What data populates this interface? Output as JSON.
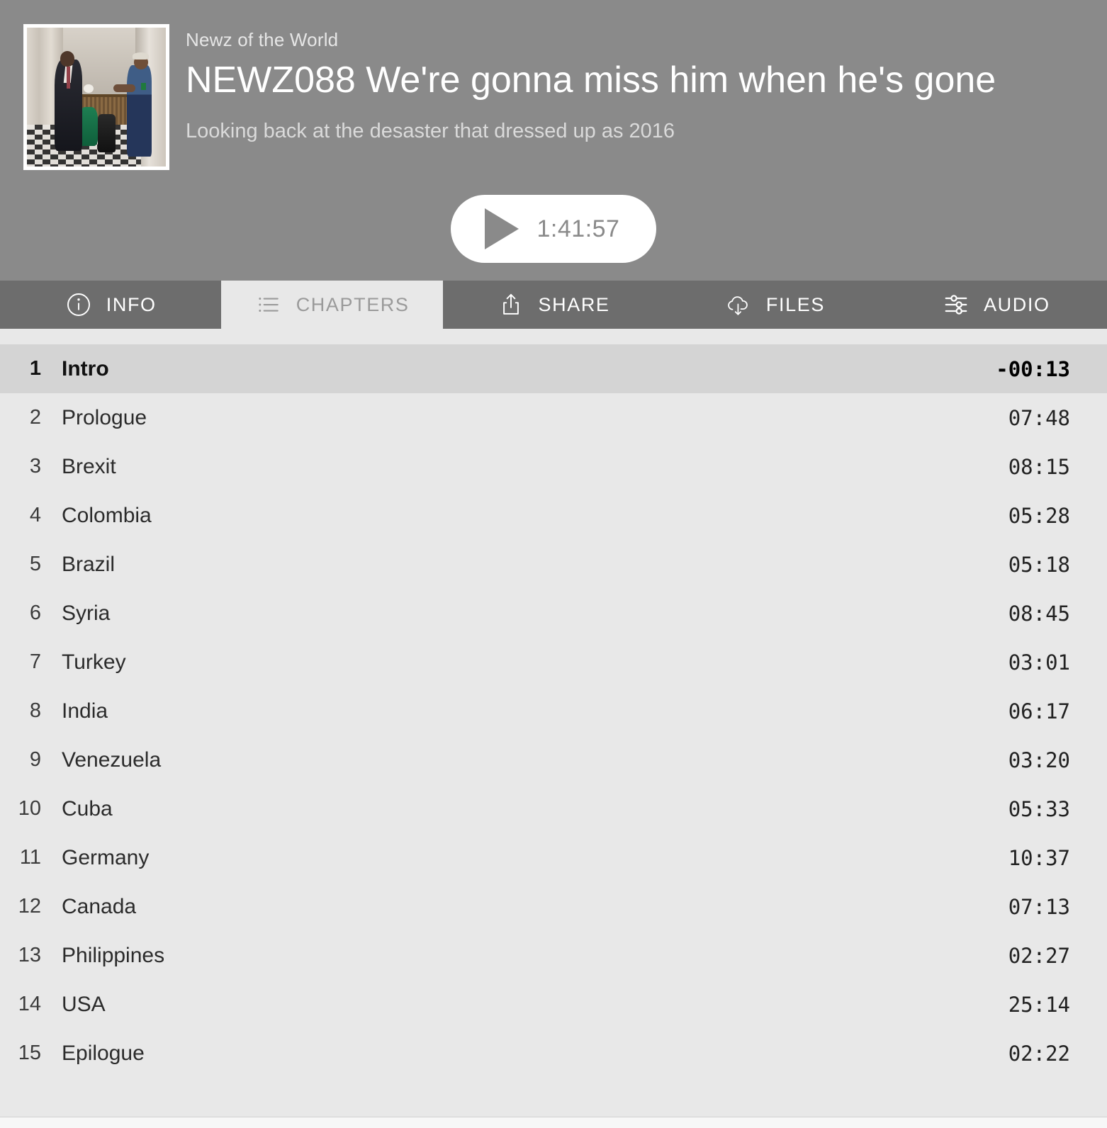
{
  "header": {
    "show_name": "Newz of the World",
    "episode_title": "NEWZ088 We're gonna miss him when he's gone",
    "episode_subtitle": "Looking back at the desaster that dressed up as 2016",
    "artwork_alt": "Obama fist-bumping a custodian in a hallway",
    "background_color": "#8a8a8a"
  },
  "player": {
    "play_label": "play",
    "duration": "1:41:57",
    "button_background": "#ffffff",
    "icon_color": "#8a8a8a"
  },
  "tabs": [
    {
      "id": "info",
      "label": "INFO",
      "icon": "info-circle-icon",
      "active": false
    },
    {
      "id": "chapters",
      "label": "CHAPTERS",
      "icon": "list-icon",
      "active": true
    },
    {
      "id": "share",
      "label": "SHARE",
      "icon": "share-icon",
      "active": false
    },
    {
      "id": "files",
      "label": "FILES",
      "icon": "cloud-download-icon",
      "active": false
    },
    {
      "id": "audio",
      "label": "AUDIO",
      "icon": "sliders-icon",
      "active": false
    }
  ],
  "tabbar": {
    "background_color": "#6d6d6d",
    "active_background_color": "#e8e8e8",
    "active_text_color": "#9a9a9a"
  },
  "chapters": {
    "list_background": "#e8e8e8",
    "current_row_background": "#d4d4d4",
    "items": [
      {
        "index": "1",
        "title": "Intro",
        "time": "-00:13",
        "current": true
      },
      {
        "index": "2",
        "title": "Prologue",
        "time": "07:48",
        "current": false
      },
      {
        "index": "3",
        "title": "Brexit",
        "time": "08:15",
        "current": false
      },
      {
        "index": "4",
        "title": "Colombia",
        "time": "05:28",
        "current": false
      },
      {
        "index": "5",
        "title": "Brazil",
        "time": "05:18",
        "current": false
      },
      {
        "index": "6",
        "title": "Syria",
        "time": "08:45",
        "current": false
      },
      {
        "index": "7",
        "title": "Turkey",
        "time": "03:01",
        "current": false
      },
      {
        "index": "8",
        "title": "India",
        "time": "06:17",
        "current": false
      },
      {
        "index": "9",
        "title": "Venezuela",
        "time": "03:20",
        "current": false
      },
      {
        "index": "10",
        "title": "Cuba",
        "time": "05:33",
        "current": false
      },
      {
        "index": "11",
        "title": "Germany",
        "time": "10:37",
        "current": false
      },
      {
        "index": "12",
        "title": "Canada",
        "time": "07:13",
        "current": false
      },
      {
        "index": "13",
        "title": "Philippines",
        "time": "02:27",
        "current": false
      },
      {
        "index": "14",
        "title": "USA",
        "time": "25:14",
        "current": false
      },
      {
        "index": "15",
        "title": "Epilogue",
        "time": "02:22",
        "current": false
      }
    ]
  }
}
